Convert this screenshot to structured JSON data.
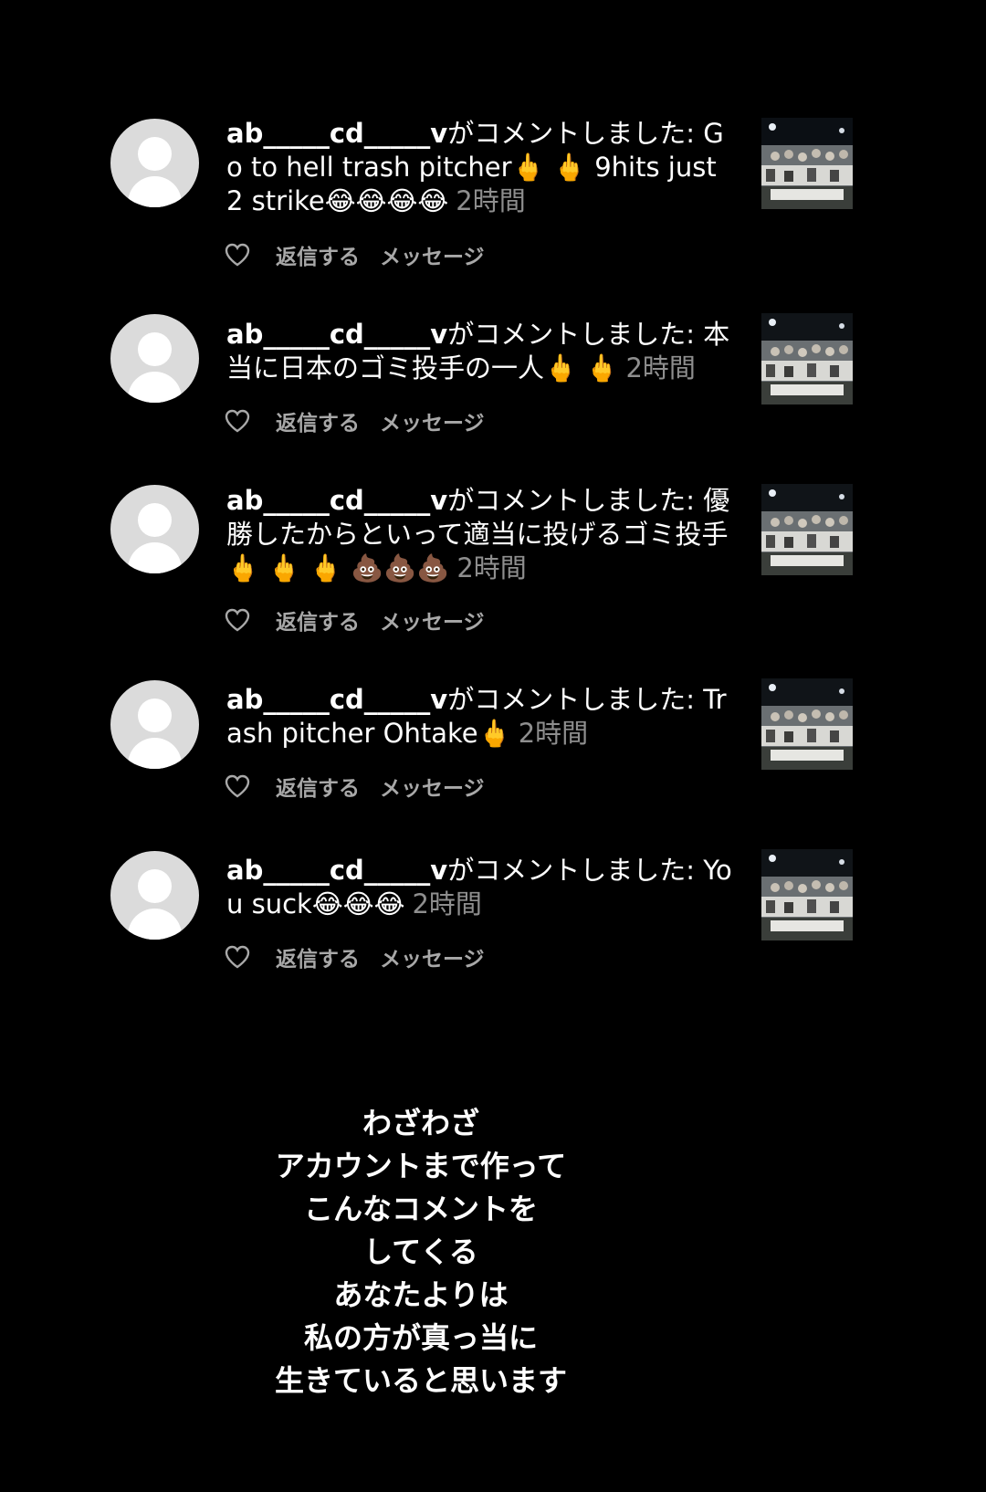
{
  "comments": [
    {
      "username": "ab_____cd_____v",
      "action": "がコメントしました:",
      "body": "Go to hell trash pitcher🖕 🖕 9hits just 2 strike😂😂😂😂",
      "time": "2時間",
      "reply_label": "返信する",
      "message_label": "メッセージ"
    },
    {
      "username": "ab_____cd_____v",
      "action": "がコメントしました:",
      "body": "本当に日本のゴミ投手の一人🖕 🖕",
      "time": "2時間",
      "reply_label": "返信する",
      "message_label": "メッセージ"
    },
    {
      "username": "ab_____cd_____v",
      "action": "がコメントしました:",
      "body": "優勝したからといって適当に投げるゴミ投手🖕 🖕 🖕 💩💩💩",
      "time": "2時間",
      "reply_label": "返信する",
      "message_label": "メッセージ"
    },
    {
      "username": "ab_____cd_____v",
      "action": "がコメントしました:",
      "body": "Trash pitcher Ohtake🖕",
      "time": "2時間",
      "reply_label": "返信する",
      "message_label": "メッセージ"
    },
    {
      "username": "ab_____cd_____v",
      "action": "がコメントしました:",
      "body": "You suck😂😂😂",
      "time": "2時間",
      "reply_label": "返信する",
      "message_label": "メッセージ"
    }
  ],
  "overlay_message": [
    "わざわざ",
    "アカウントまで作って",
    "こんなコメントを",
    "してくる",
    "あなたよりは",
    "私の方が真っ当に",
    "生きていると思います"
  ],
  "colors": {
    "background": "#000000",
    "text": "#ffffff",
    "secondary_text": "#8e8e8e",
    "action_text": "#a8a8a8",
    "avatar": "#dbdbdb"
  },
  "icons": {
    "like": "heart-outline-icon",
    "avatar": "default-avatar-icon"
  }
}
